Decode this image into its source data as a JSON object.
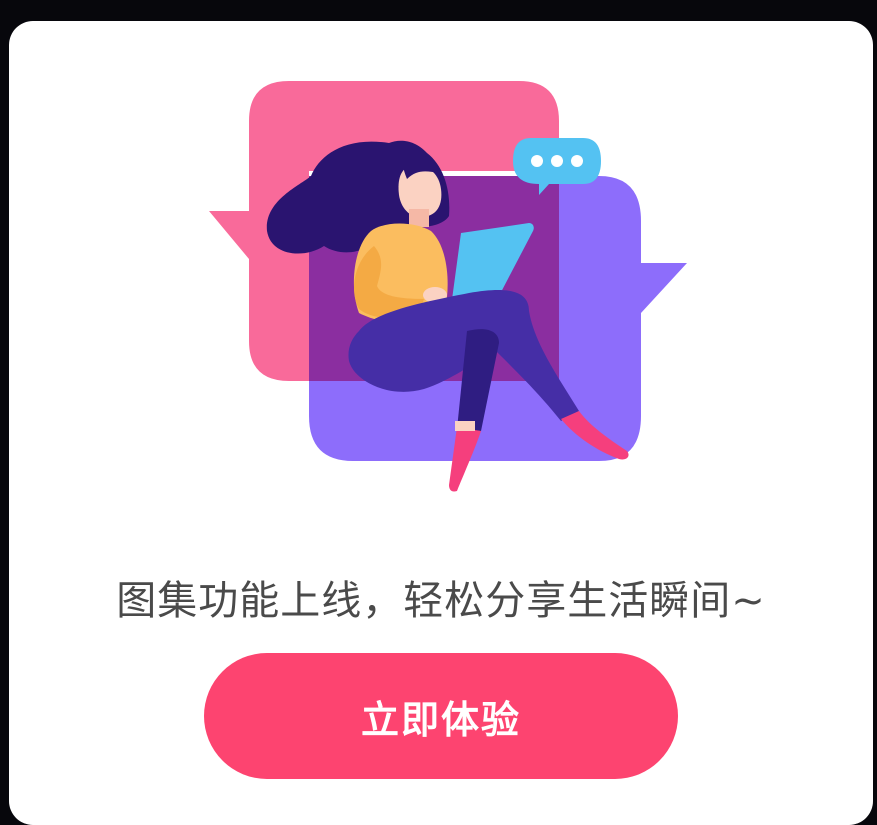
{
  "dialog": {
    "message": "图集功能上线，轻松分享生活瞬间~",
    "cta_label": "立即体验"
  },
  "illustration": {
    "subject": "woman-with-tablet-chat-bubbles-illustration",
    "icons": [
      "chat-bubble-pink",
      "chat-bubble-purple",
      "typing-bubble-icon"
    ]
  },
  "colors": {
    "accent": "#fd4470",
    "text": "#4a4a4a",
    "bubble_pink": "#f96a9a",
    "bubble_purple": "#8d6dfb",
    "overlap": "#8b2ea0",
    "typing_bubble": "#54c2f2",
    "backdrop": "#07070c",
    "card": "#ffffff"
  }
}
